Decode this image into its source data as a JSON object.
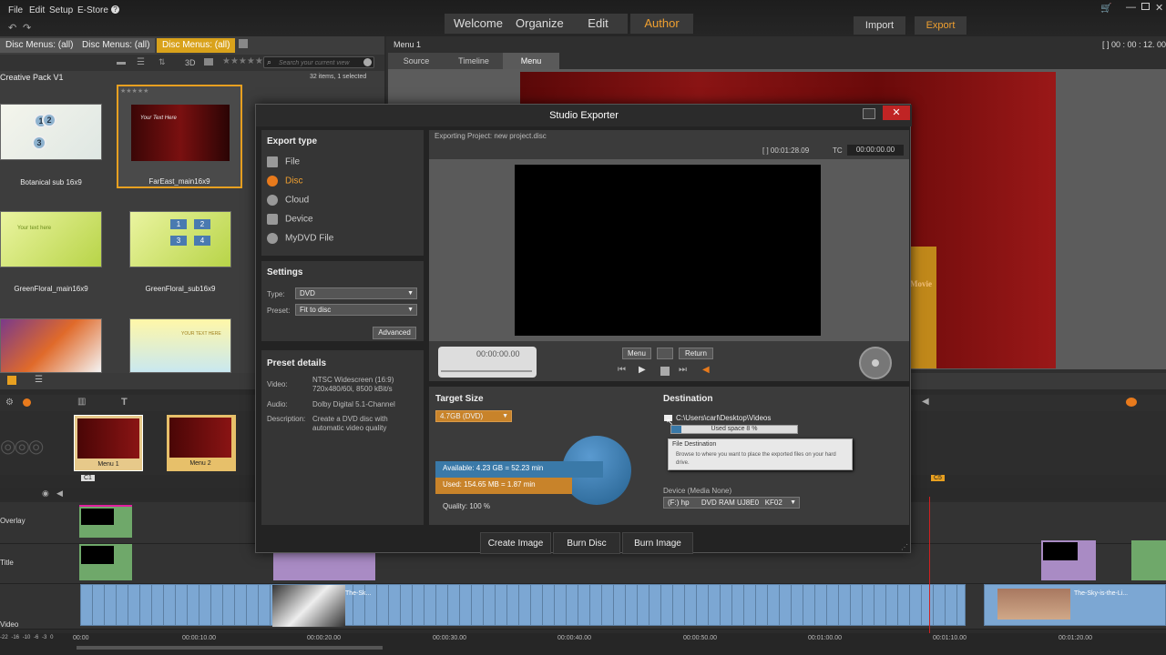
{
  "menu": {
    "file": "File",
    "edit": "Edit",
    "setup": "Setup",
    "estore": "E-Store",
    "help": "?"
  },
  "nav": {
    "tabs": [
      "Welcome",
      "Organize",
      "Edit",
      "Author"
    ],
    "active": "Author",
    "import": "Import",
    "export": "Export"
  },
  "library": {
    "tabs": [
      "Disc Menus: (all)",
      "Disc Menus: (all)",
      "Disc Menus: (all)"
    ],
    "search_placeholder": "Search your current view",
    "count": "32 items, 1 selected",
    "pack": "Creative Pack V1",
    "view3d": "3D",
    "items": [
      {
        "name": "Botanical sub 16x9"
      },
      {
        "name": "FarEast_main16x9",
        "selected": true
      },
      {
        "name": "GreenFloral_main16x9"
      },
      {
        "name": "GreenFloral_sub16x9"
      }
    ],
    "thumb_text": {
      "fareast": "Your Text Here",
      "green": "Your text here",
      "yellow": "YOUR TEXT HERE",
      "nums": [
        "1",
        "2",
        "3",
        "4"
      ],
      "botanical": [
        "1",
        "2",
        "3"
      ]
    }
  },
  "player": {
    "title": "Menu 1",
    "timecode": "[ ] 00 : 00 : 12. 00",
    "tabs": [
      "Source",
      "Timeline",
      "Menu"
    ],
    "active_tab": "Menu",
    "preview_text": "Movie"
  },
  "dialog": {
    "title": "Studio Exporter",
    "export_type": {
      "heading": "Export type",
      "options": [
        "File",
        "Disc",
        "Cloud",
        "Device",
        "MyDVD File"
      ],
      "selected": "Disc"
    },
    "settings": {
      "heading": "Settings",
      "type_label": "Type:",
      "type_value": "DVD",
      "preset_label": "Preset:",
      "preset_value": "Fit to disc",
      "advanced": "Advanced"
    },
    "preset_details": {
      "heading": "Preset details",
      "video_label": "Video:",
      "video_value": "NTSC Widescreen (16:9) 720x480/60i, 8500 kBit/s",
      "audio_label": "Audio:",
      "audio_value": "Dolby Digital 5.1-Channel",
      "desc_label": "Description:",
      "desc_value": "Create a DVD disc with automatic video quality"
    },
    "exporting": "Exporting Project: new project.disc",
    "duration": "[ ] 00:01:28.09",
    "tc_label": "TC",
    "tc_value": "00:00:00.00",
    "scrub_time": "00:00:00.00",
    "menu_btn": "Menu",
    "return_btn": "Return",
    "target": {
      "heading": "Target Size",
      "value": "4.7GB (DVD)",
      "available": "Available: 4.23 GB = 52.23 min",
      "used": "Used: 154.65 MB = 1.87 min",
      "quality": "Quality:  100 %",
      "used_fraction": 0.03
    },
    "destination": {
      "heading": "Destination",
      "path": "C:\\Users\\carl\\Desktop\\Videos",
      "used_space": "Used space 8 %",
      "used_space_fraction": 0.08,
      "tooltip_title": "File Destination",
      "tooltip_text": "Browse to where you want to place the exported files on your hard drive.",
      "device_label": "Device  (Media None)",
      "device_value": "(F:) hp      DVD RAM UJ8E0   KF02"
    },
    "actions": [
      "Create Image",
      "Burn Disc",
      "Burn Image"
    ]
  },
  "timeline": {
    "menus": [
      "Menu 1",
      "Menu 2"
    ],
    "chapter": "C1",
    "chapter2": "C5",
    "tracks": [
      "Overlay",
      "Title",
      "Video"
    ],
    "clip_labels": [
      "The-Sk...",
      "The-Sky-is-the-Li..."
    ],
    "ruler": [
      "00:00",
      "00:00:10.00",
      "00:00:20.00",
      "00:00:30.00",
      "00:00:40.00",
      "00:00:50.00",
      "00:01:00.00",
      "00:01:10.00",
      "00:01:20.00"
    ],
    "meter": [
      "-22",
      "-16",
      "-10",
      "-6",
      "-3",
      "0"
    ]
  },
  "colors": {
    "accent": "#e8a020",
    "dialog_bg": "#232323",
    "disc_orange": "#e87a1c",
    "available_blue": "#3a79a8",
    "used_orange": "#c8832a"
  }
}
